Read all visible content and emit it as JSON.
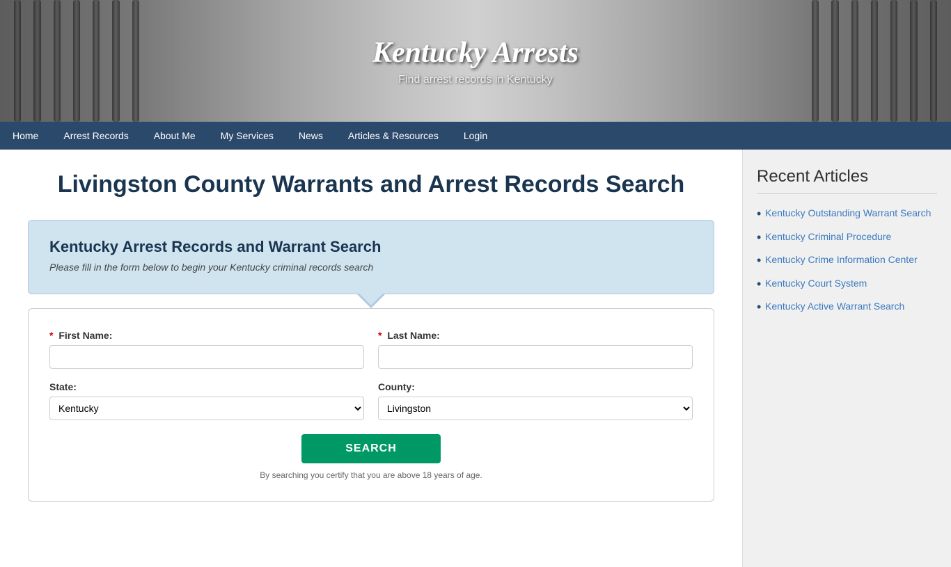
{
  "header": {
    "title": "Kentucky Arrests",
    "subtitle": "Find arrest records in Kentucky"
  },
  "nav": {
    "items": [
      {
        "label": "Home",
        "active": false
      },
      {
        "label": "Arrest Records",
        "active": false
      },
      {
        "label": "About Me",
        "active": false
      },
      {
        "label": "My Services",
        "active": false
      },
      {
        "label": "News",
        "active": false
      },
      {
        "label": "Articles & Resources",
        "active": false
      },
      {
        "label": "Login",
        "active": false
      }
    ]
  },
  "page": {
    "title": "Livingston County Warrants and Arrest Records Search"
  },
  "search_card": {
    "title": "Kentucky Arrest Records and Warrant Search",
    "subtitle": "Please fill in the form below to begin your Kentucky criminal records search"
  },
  "form": {
    "first_name_label": "First Name:",
    "last_name_label": "Last Name:",
    "state_label": "State:",
    "county_label": "County:",
    "state_value": "Kentucky",
    "county_value": "Livingston",
    "search_button": "SEARCH",
    "disclaimer": "By searching you certify that you are above 18 years of age."
  },
  "sidebar": {
    "title": "Recent Articles",
    "articles": [
      {
        "label": "Kentucky Outstanding Warrant Search"
      },
      {
        "label": "Kentucky Criminal Procedure"
      },
      {
        "label": "Kentucky Crime Information Center"
      },
      {
        "label": "Kentucky Court System"
      },
      {
        "label": "Kentucky Active Warrant Search"
      }
    ]
  }
}
